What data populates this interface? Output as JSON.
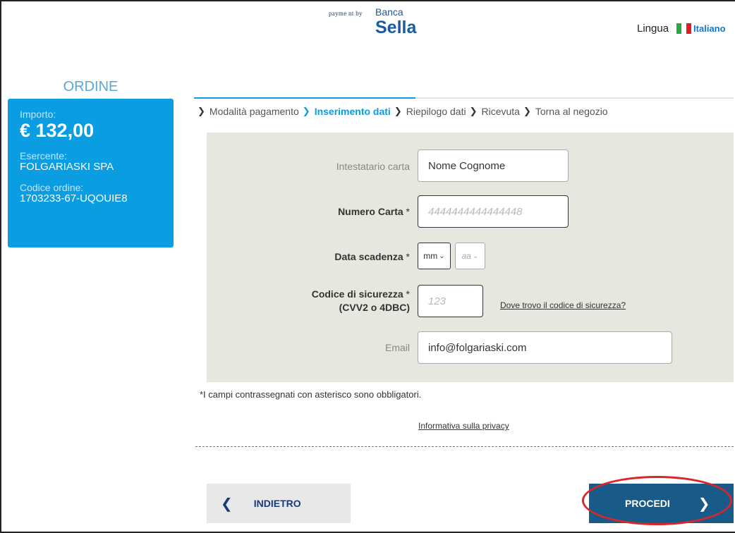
{
  "header": {
    "brand_small": "payme nt by",
    "brand_banca": "Banca",
    "brand_sella": "Sella",
    "lingua_label": "Lingua",
    "language_selected": "Italiano"
  },
  "sidebar": {
    "title": "ORDINE",
    "importo_label": "Importo:",
    "importo_value": "€ 132,00",
    "esercente_label": "Esercente:",
    "esercente_value": "FOLGARIASKI SPA",
    "codice_label": "Codice ordine:",
    "codice_value": "1703233-67-UQOUIE8"
  },
  "steps": [
    {
      "label": "Modalità pagamento",
      "active": false
    },
    {
      "label": "Inserimento dati",
      "active": true
    },
    {
      "label": "Riepilogo dati",
      "active": false
    },
    {
      "label": "Ricevuta",
      "active": false
    },
    {
      "label": "Torna al negozio",
      "active": false
    }
  ],
  "form": {
    "holder_label": "Intestatario carta",
    "holder_value": "Nome Cognome",
    "card_label": "Numero Carta",
    "card_placeholder": "4444444444444448",
    "expiry_label": "Data scadenza",
    "expiry_month": "mm",
    "expiry_year": "aa",
    "cvv_label_line1": "Codice di sicurezza",
    "cvv_label_line2": "(CVV2 o 4DBC)",
    "cvv_placeholder": "123",
    "cvv_help": "Dove trovo il codice di sicurezza?",
    "email_label": "Email",
    "email_value": "info@folgariaski.com",
    "required_mark": "*"
  },
  "footer": {
    "required_note": "*I campi contrassegnati con asterisco sono obbligatori.",
    "privacy_link": "Informativa sulla privacy",
    "back_button": "INDIETRO",
    "proceed_button": "PROCEDI"
  },
  "colors": {
    "accent": "#0a9de1",
    "button_primary": "#185a88",
    "highlight": "#d9262b"
  }
}
